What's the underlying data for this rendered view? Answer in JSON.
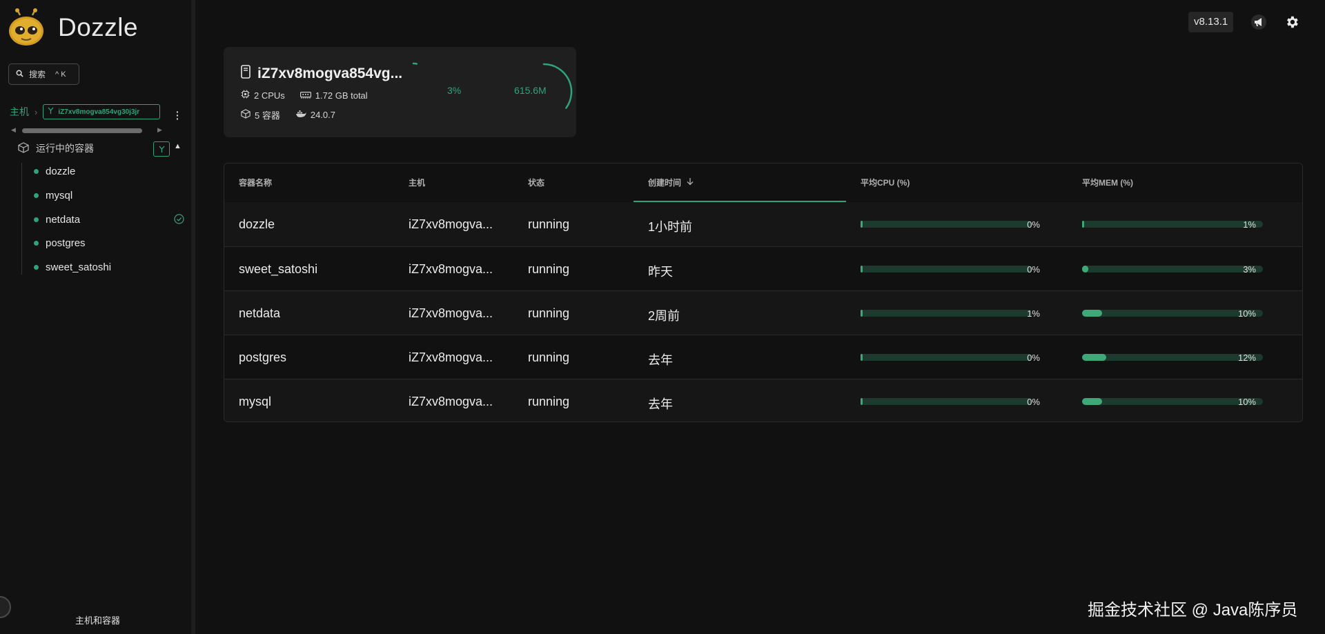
{
  "app": {
    "title": "Dozzle",
    "version": "v8.13.1"
  },
  "sidebar": {
    "search_label": "搜索",
    "search_shortcut": "^ K",
    "breadcrumb_home": "主机",
    "breadcrumb_host": "iZ7xv8mogva854vg30j3jr",
    "group_label": "运行中的容器",
    "containers": [
      {
        "name": "dozzle",
        "checked": false
      },
      {
        "name": "mysql",
        "checked": false
      },
      {
        "name": "netdata",
        "checked": true
      },
      {
        "name": "postgres",
        "checked": false
      },
      {
        "name": "sweet_satoshi",
        "checked": false
      }
    ],
    "footer_label": "主机和容器"
  },
  "host_card": {
    "name": "iZ7xv8mogva854vg...",
    "cpus": "2 CPUs",
    "memory": "1.72 GB total",
    "containers": "5 容器",
    "docker_version": "24.0.7",
    "cpu_usage": "3%",
    "cpu_fraction": 0.03,
    "mem_usage": "615.6M",
    "mem_fraction": 0.35
  },
  "table": {
    "headers": {
      "name": "容器名称",
      "host": "主机",
      "state": "状态",
      "created": "创建时间",
      "cpu": "平均CPU (%)",
      "mem": "平均MEM (%)"
    },
    "rows": [
      {
        "name": "dozzle",
        "host": "iZ7xv8mogva...",
        "state": "running",
        "created": "1小时前",
        "cpu": 0,
        "cpu_label": "0%",
        "mem": 1,
        "mem_label": "1%"
      },
      {
        "name": "sweet_satoshi",
        "host": "iZ7xv8mogva...",
        "state": "running",
        "created": "昨天",
        "cpu": 0,
        "cpu_label": "0%",
        "mem": 3,
        "mem_label": "3%"
      },
      {
        "name": "netdata",
        "host": "iZ7xv8mogva...",
        "state": "running",
        "created": "2周前",
        "cpu": 1,
        "cpu_label": "1%",
        "mem": 10,
        "mem_label": "10%"
      },
      {
        "name": "postgres",
        "host": "iZ7xv8mogva...",
        "state": "running",
        "created": "去年",
        "cpu": 0,
        "cpu_label": "0%",
        "mem": 12,
        "mem_label": "12%"
      },
      {
        "name": "mysql",
        "host": "iZ7xv8mogva...",
        "state": "running",
        "created": "去年",
        "cpu": 0,
        "cpu_label": "0%",
        "mem": 10,
        "mem_label": "10%"
      }
    ]
  },
  "watermark": "掘金技术社区 @ Java陈序员",
  "colors": {
    "accent": "#2fa37a",
    "bar_track": "#1d3a2e",
    "bar_fill": "#3fa877"
  }
}
